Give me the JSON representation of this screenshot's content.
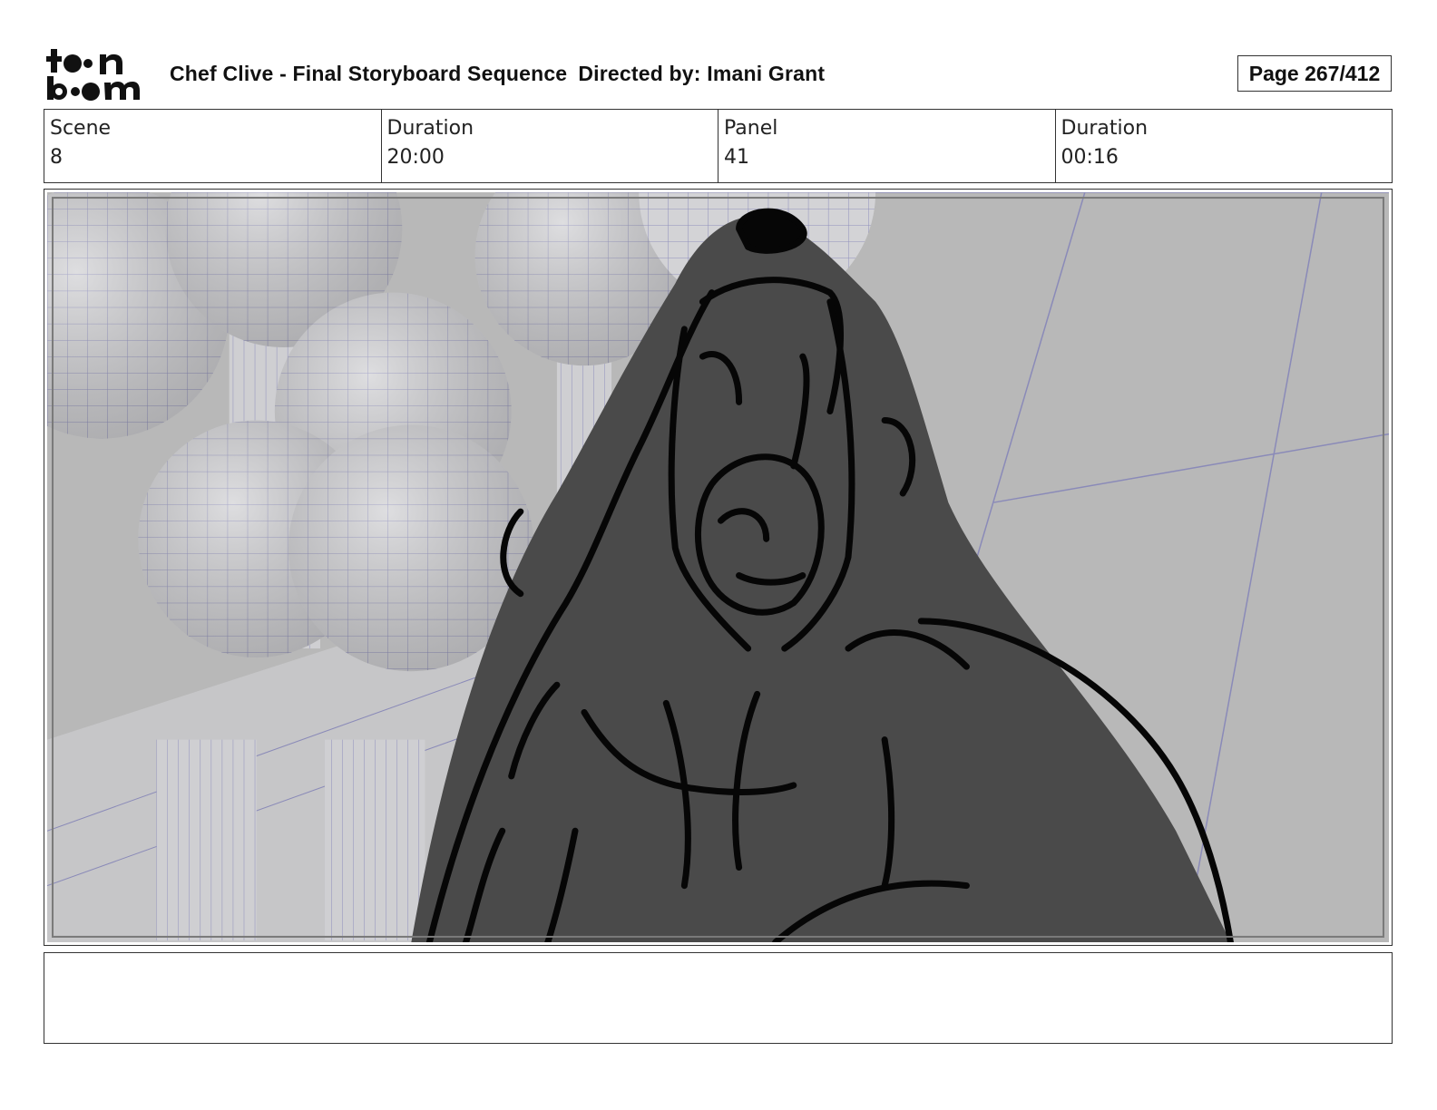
{
  "header": {
    "logo_text": "toon boom",
    "title": "Chef Clive - Final Storyboard Sequence",
    "director": "Directed by: Imani Grant",
    "page_label": "Page 267/412"
  },
  "info": [
    {
      "label": "Scene",
      "value": "8"
    },
    {
      "label": "Duration",
      "value": "20:00"
    },
    {
      "label": "Panel",
      "value": "41"
    },
    {
      "label": "Duration",
      "value": "00:16"
    }
  ],
  "panel": {
    "description": "",
    "colors": {
      "background": "#b9b9b9",
      "mesh_lines": "#8a8ab8",
      "spheres": "#d4d4d6",
      "bear_fill": "#4a4a4a",
      "ink": "#050505"
    }
  },
  "notes": {
    "text": ""
  }
}
